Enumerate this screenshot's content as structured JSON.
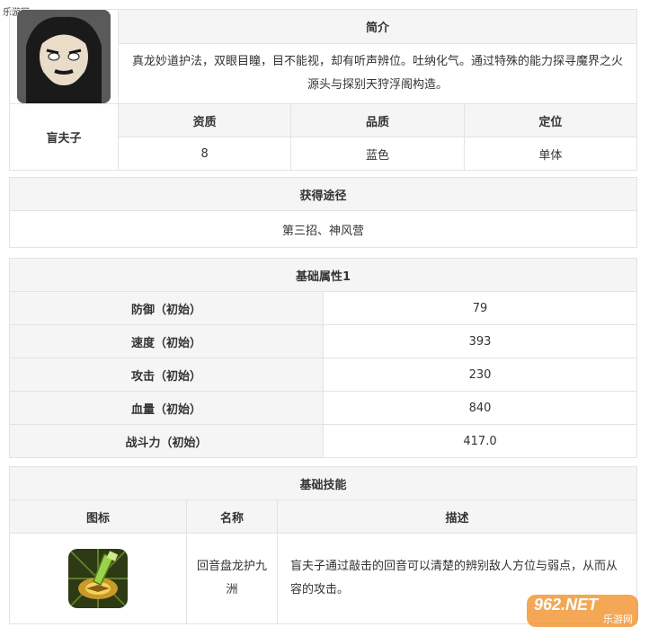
{
  "watermark_top": "乐游网 www.962.net",
  "intro": {
    "header": "简介",
    "name": "盲夫子",
    "text": "真龙妙道护法，双眼目瞳，目不能视，却有听声辨位。吐纳化气。通过特殊的能力探寻魔界之火源头与探别天狩浮阁构造。",
    "columns": [
      "资质",
      "品质",
      "定位"
    ],
    "values": [
      "8",
      "蓝色",
      "单体"
    ],
    "colors": {
      "header_bg": "#f5f5f5",
      "border": "#e3e3e3"
    }
  },
  "obtain": {
    "header": "获得途径",
    "value": "第三招、神风营"
  },
  "attrs": {
    "header": "基础属性1",
    "rows": [
      {
        "label": "防御（初始）",
        "value": "79"
      },
      {
        "label": "速度（初始）",
        "value": "393"
      },
      {
        "label": "攻击（初始）",
        "value": "230"
      },
      {
        "label": "血量（初始）",
        "value": "840"
      },
      {
        "label": "战斗力（初始）",
        "value": "417.0"
      }
    ]
  },
  "skills": {
    "header": "基础技能",
    "columns": [
      "图标",
      "名称",
      "描述"
    ],
    "row": {
      "icon": "dragon-strike-skill-icon",
      "name": "回音盘龙护九洲",
      "desc": "盲夫子通过敲击的回音可以清楚的辨别敌人方位与弱点，从而从容的攻击。"
    }
  },
  "watermark_logo": {
    "brand": "962.NET",
    "sub": "乐游网"
  }
}
